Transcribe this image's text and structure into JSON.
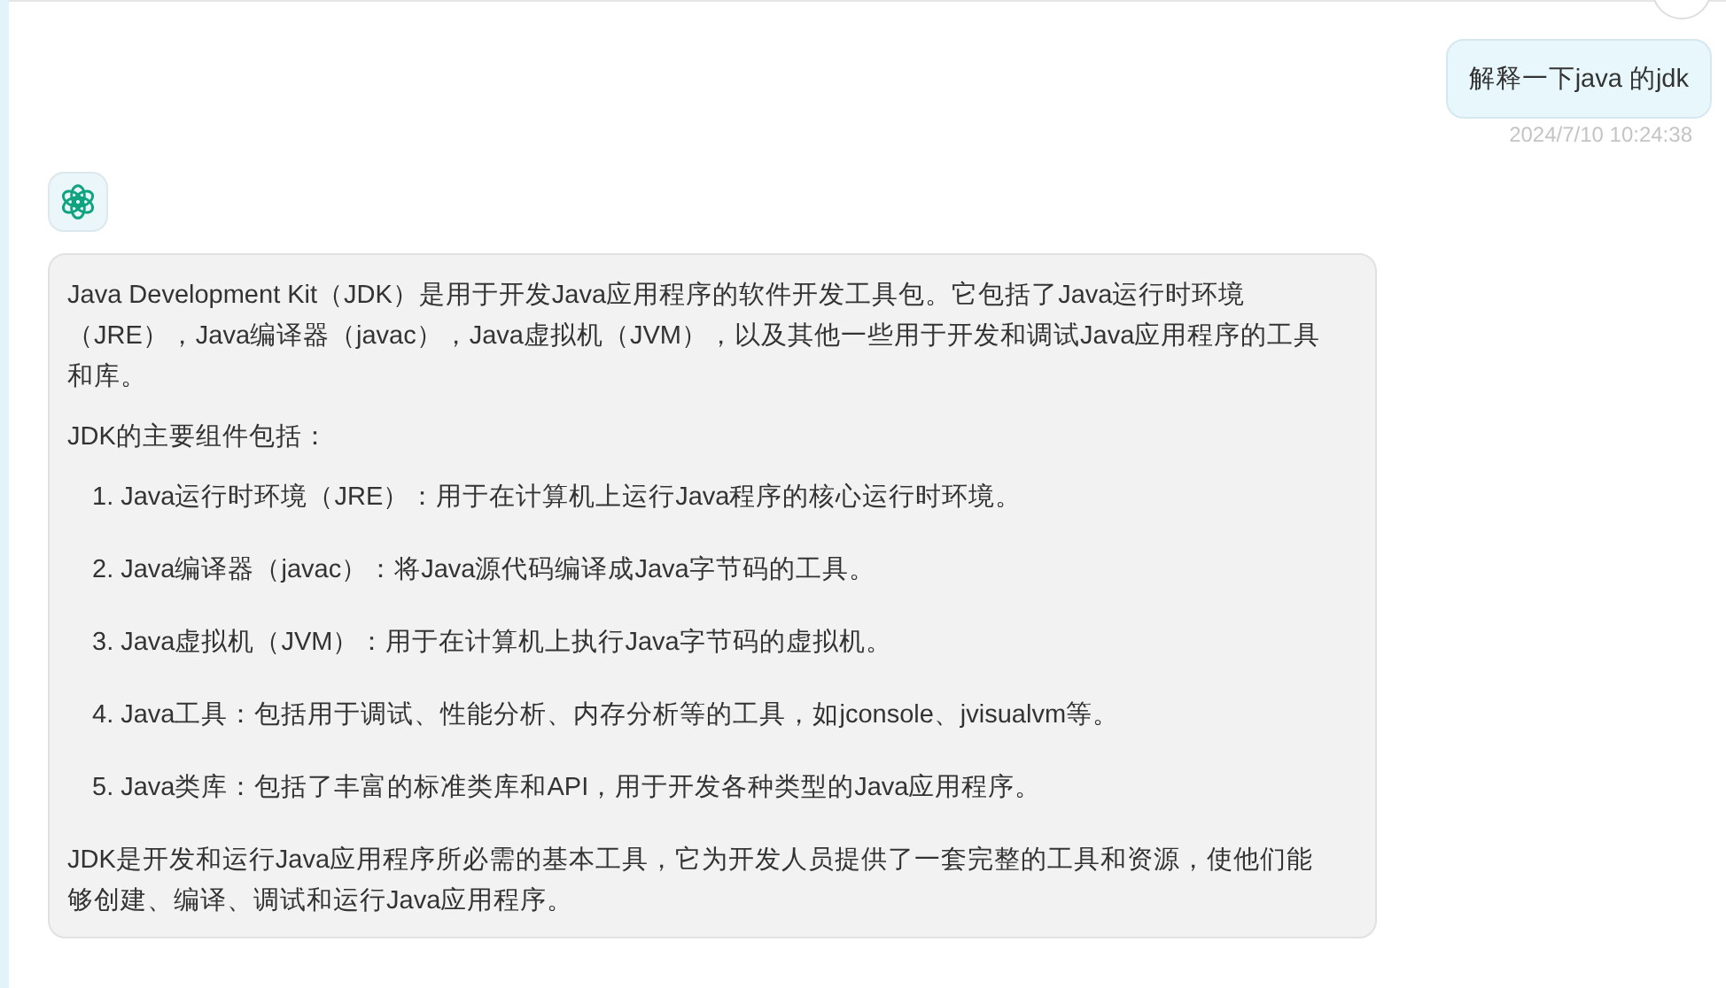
{
  "user_message": {
    "text": "解释一下java 的jdk",
    "timestamp": "2024/7/10 10:24:38"
  },
  "assistant_message": {
    "intro": "Java Development Kit（JDK）是用于开发Java应用程序的软件开发工具包。它包括了Java运行时环境（JRE），Java编译器（javac），Java虚拟机（JVM），以及其他一些用于开发和调试Java应用程序的工具和库。",
    "list_heading": "JDK的主要组件包括：",
    "items": [
      {
        "number": "1.",
        "text": "Java运行时环境（JRE）：用于在计算机上运行Java程序的核心运行时环境。"
      },
      {
        "number": "2.",
        "text": "Java编译器（javac）：将Java源代码编译成Java字节码的工具。"
      },
      {
        "number": "3.",
        "text": "Java虚拟机（JVM）：用于在计算机上执行Java字节码的虚拟机。"
      },
      {
        "number": "4.",
        "text": "Java工具：包括用于调试、性能分析、内存分析等的工具，如jconsole、jvisualvm等。"
      },
      {
        "number": "5.",
        "text": "Java类库：包括了丰富的标准类库和API，用于开发各种类型的Java应用程序。"
      }
    ],
    "conclusion": "JDK是开发和运行Java应用程序所必需的基本工具，它为开发人员提供了一套完整的工具和资源，使他们能够创建、编译、调试和运行Java应用程序。"
  }
}
